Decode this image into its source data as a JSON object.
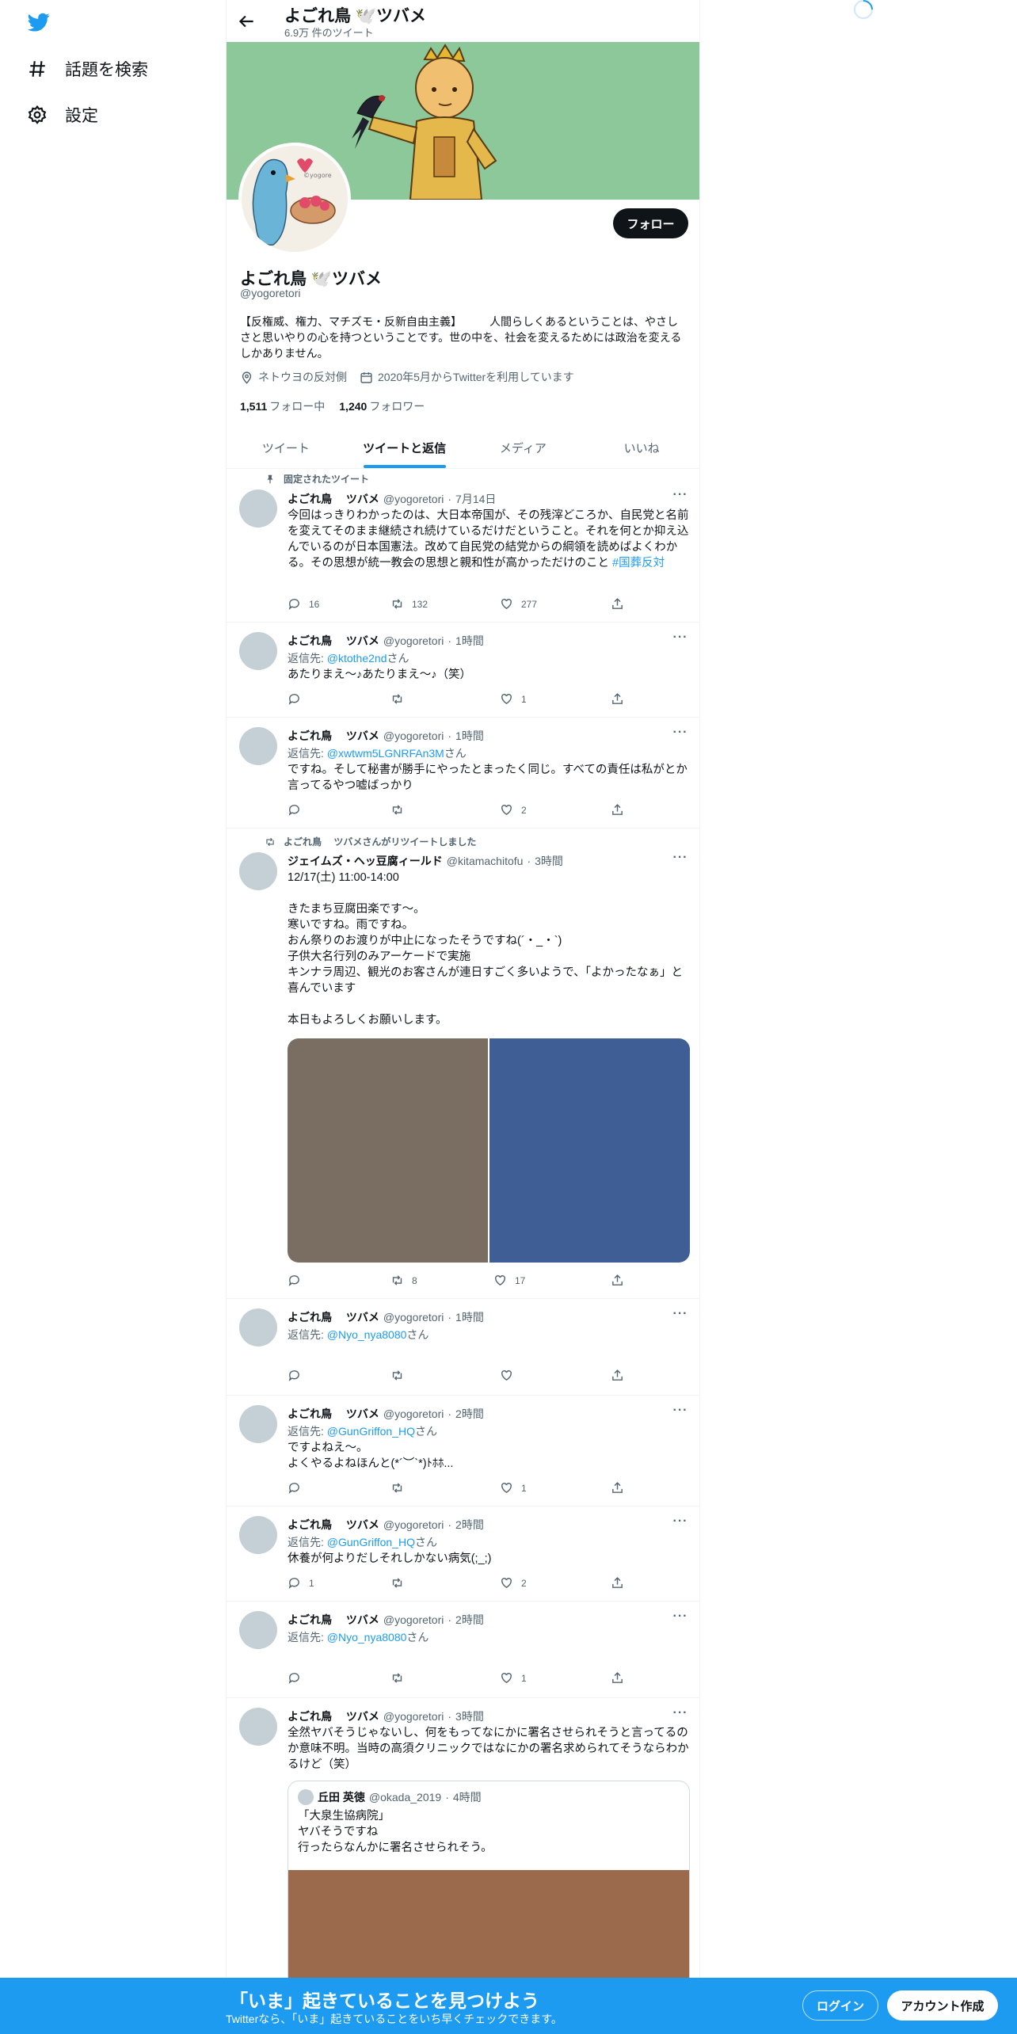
{
  "nav": {
    "explore_label": "話題を検索",
    "settings_label": "設定"
  },
  "header": {
    "title": "よごれ鳥 🕊️ツバメ",
    "tweet_count": "6.9万 件のツイート"
  },
  "profile": {
    "follow_label": "フォロー",
    "display_name": "よごれ鳥 🕊️ツバメ",
    "handle": "@yogoretori",
    "bio": "【反権威、権力、マチズモ・反新自由主義】　　　人間らしくあるということは、やさしさと思いやりの心を持つということです。世の中を、社会を変えるためには政治を変えるしかありません。",
    "location": "ネトウヨの反対側",
    "joined": "2020年5月からTwitterを利用しています",
    "following_count": "1,511",
    "following_label": "フォロー中",
    "followers_count": "1,240",
    "followers_label": "フォロワー"
  },
  "tabs": [
    {
      "label": "ツイート"
    },
    {
      "label": "ツイートと返信"
    },
    {
      "label": "メディア"
    },
    {
      "label": "いいね"
    }
  ],
  "tweets": [
    {
      "context": "固定されたツイート",
      "name": "よごれ鳥　 ツバメ",
      "handle": "@yogoretori",
      "time": "7月14日",
      "text": "今回はっきりわかったのは、大日本帝国が、その残滓どころか、自民党と名前を変えてそのまま継続され続けているだけだということ。それを何とか抑え込んでいるのが日本国憲法。改めて自民党の結党からの綱領を読めばよくわかる。その思想が統一教会の思想と親和性が高かっただけのこと",
      "hashtag": "#国葬反対",
      "replies": "16",
      "retweets": "132",
      "likes": "277"
    },
    {
      "name": "よごれ鳥　 ツバメ",
      "handle": "@yogoretori",
      "time": "1時間",
      "reply_prefix": "返信先: ",
      "reply_to": "@ktothe2nd",
      "reply_suffix": "さん",
      "text": "あたりまえ～♪あたりまえ～♪（笑）",
      "replies": "",
      "retweets": "",
      "likes": "1"
    },
    {
      "name": "よごれ鳥　 ツバメ",
      "handle": "@yogoretori",
      "time": "1時間",
      "reply_prefix": "返信先: ",
      "reply_to": "@xwtwm5LGNRFAn3M",
      "reply_suffix": "さん",
      "text": "ですね。そして秘書が勝手にやったとまったく同じ。すべての責任は私がとか言ってるやつ嘘ばっかり",
      "replies": "",
      "retweets": "",
      "likes": "2"
    },
    {
      "context": "よごれ鳥　 ツバメさんがリツイートしました",
      "name": "ジェイムズ・ヘッ豆腐ィールド",
      "handle": "@kitamachitofu",
      "time": "3時間",
      "text": "12/17(土) 11:00-14:00\n\nきたまち豆腐田楽です〜。\n寒いですね。雨ですね。\nおん祭りのお渡りが中止になったそうですね(´・_・`)\n子供大名行列のみアーケードで実施\nキンナラ周辺、観光のお客さんが連日すごく多いようで、「よかったなぁ」と喜んでいます\n\n本日もよろしくお願いします。",
      "replies": "",
      "retweets": "8",
      "likes": "17"
    },
    {
      "name": "よごれ鳥　 ツバメ",
      "handle": "@yogoretori",
      "time": "1時間",
      "reply_prefix": "返信先: ",
      "reply_to": "@Nyo_nya8080",
      "reply_suffix": "さん",
      "text": "",
      "replies": "",
      "retweets": "",
      "likes": ""
    },
    {
      "name": "よごれ鳥　 ツバメ",
      "handle": "@yogoretori",
      "time": "2時間",
      "reply_prefix": "返信先: ",
      "reply_to": "@GunGriffon_HQ",
      "reply_suffix": "さん",
      "text": "ですよねえ～。\nよくやるよねほんと(*´︶`*)ﾄﾎﾎ...",
      "replies": "",
      "retweets": "",
      "likes": "1"
    },
    {
      "name": "よごれ鳥　 ツバメ",
      "handle": "@yogoretori",
      "time": "2時間",
      "reply_prefix": "返信先: ",
      "reply_to": "@GunGriffon_HQ",
      "reply_suffix": "さん",
      "text": "休養が何よりだしそれしかない病気(;_;)",
      "replies": "1",
      "retweets": "",
      "likes": "2"
    },
    {
      "name": "よごれ鳥　 ツバメ",
      "handle": "@yogoretori",
      "time": "2時間",
      "reply_prefix": "返信先: ",
      "reply_to": "@Nyo_nya8080",
      "reply_suffix": "さん",
      "text": "",
      "replies": "",
      "retweets": "",
      "likes": "1"
    },
    {
      "name": "よごれ鳥　 ツバメ",
      "handle": "@yogoretori",
      "time": "3時間",
      "text": "全然ヤバそうじゃないし、何をもってなにかに署名させられそうと言ってるのか意味不明。当時の高須クリニックではなにかの署名求められてそうならわかるけど（笑）",
      "quote": {
        "name": "丘田 英徳",
        "handle": "@okada_2019",
        "time": "4時間",
        "text": "「大泉生協病院」\nヤバそうですね\n行ったらなんかに署名させられそう。"
      }
    }
  ],
  "bottom": {
    "title": "「いま」起きていることを見つけよう",
    "subtitle": "Twitterなら、「いま」起きていることをいち早くチェックできます。",
    "login_label": "ログイン",
    "signup_label": "アカウント作成"
  },
  "colors": {
    "accent": "#1d9bf0",
    "banner": "#8cc899",
    "text": "#0f1419",
    "secondary": "#536471"
  }
}
